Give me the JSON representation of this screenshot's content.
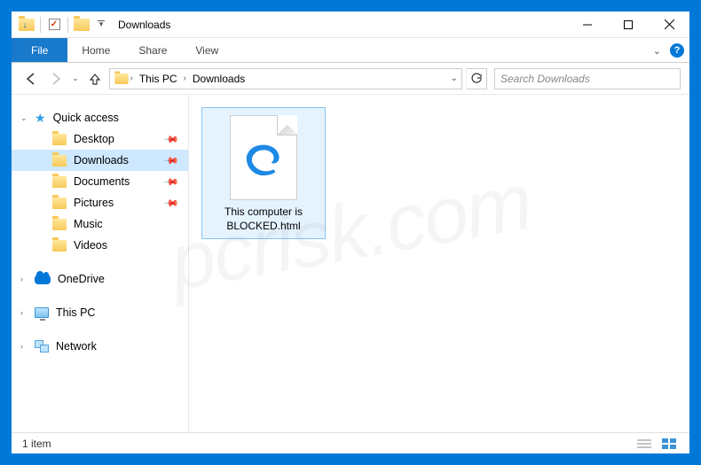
{
  "title": "Downloads",
  "ribbon": {
    "file": "File",
    "tabs": [
      "Home",
      "Share",
      "View"
    ]
  },
  "breadcrumb": {
    "items": [
      "This PC",
      "Downloads"
    ]
  },
  "search": {
    "placeholder": "Search Downloads"
  },
  "sidebar": {
    "quick_access": "Quick access",
    "pinned": [
      {
        "label": "Desktop"
      },
      {
        "label": "Downloads",
        "selected": true
      },
      {
        "label": "Documents"
      },
      {
        "label": "Pictures"
      }
    ],
    "others": [
      {
        "label": "Music"
      },
      {
        "label": "Videos"
      }
    ],
    "roots": [
      {
        "label": "OneDrive",
        "icon": "onedrive"
      },
      {
        "label": "This PC",
        "icon": "monitor"
      },
      {
        "label": "Network",
        "icon": "network"
      }
    ]
  },
  "files": [
    {
      "name": "This computer is BLOCKED.html"
    }
  ],
  "status": {
    "count": "1 item"
  },
  "watermark": "pcrisk.com"
}
